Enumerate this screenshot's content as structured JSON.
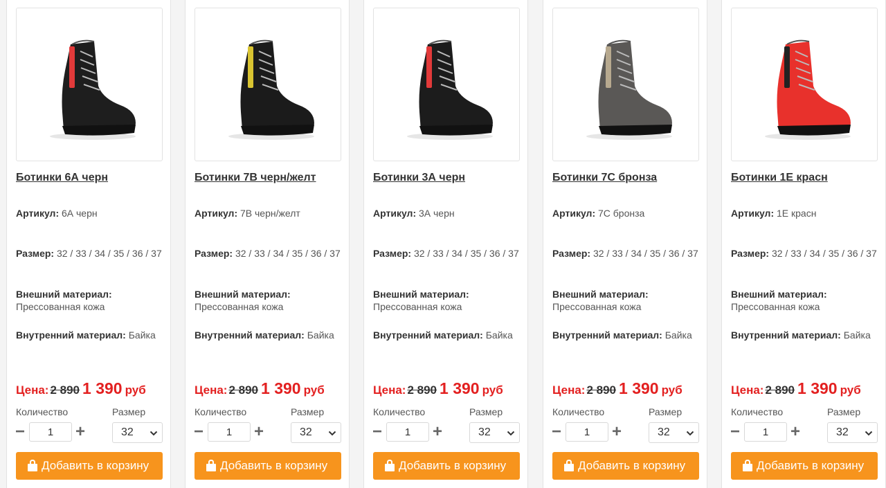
{
  "labels": {
    "article": "Артикул:",
    "size": "Размер:",
    "outer": "Внешний материал:",
    "inner": "Внутренний материал:",
    "price": "Цена:",
    "currency": "руб",
    "quantity": "Количество",
    "size_select": "Размер",
    "add_to_cart": "Добавить в корзину",
    "minus": "−",
    "plus": "+"
  },
  "products": [
    {
      "title": "Ботинки 6А черн",
      "article": "6А черн",
      "sizes": "32 / 33 / 34 / 35 / 36 / 37",
      "outer_material": "Прессованная кожа",
      "inner_material": "Байка",
      "old_price": "2 890",
      "new_price": "1 390",
      "quantity": "1",
      "selected_size": "32",
      "image": "boot-black-red-laces"
    },
    {
      "title": "Ботинки 7В черн/желт",
      "article": "7В черн/желт",
      "sizes": "32 / 33 / 34 / 35 / 36 / 37",
      "outer_material": "Прессованная кожа",
      "inner_material": "Байка",
      "old_price": "2 890",
      "new_price": "1 390",
      "quantity": "1",
      "selected_size": "32",
      "image": "boot-black-yellow"
    },
    {
      "title": "Ботинки 3А черн",
      "article": "3А черн",
      "sizes": "32 / 33 / 34 / 35 / 36 / 37",
      "outer_material": "Прессованная кожа",
      "inner_material": "Байка",
      "old_price": "2 890",
      "new_price": "1 390",
      "quantity": "1",
      "selected_size": "32",
      "image": "boot-black-suede"
    },
    {
      "title": "Ботинки 7С бронза",
      "article": "7С бронза",
      "sizes": "32 / 33 / 34 / 35 / 36 / 37",
      "outer_material": "Прессованная кожа",
      "inner_material": "Байка",
      "old_price": "2 890",
      "new_price": "1 390",
      "quantity": "1",
      "selected_size": "32",
      "image": "boot-bronze"
    },
    {
      "title": "Ботинки 1Е красн",
      "article": "1Е красн",
      "sizes": "32 / 33 / 34 / 35 / 36 / 37",
      "outer_material": "Прессованная кожа",
      "inner_material": "Байка",
      "old_price": "2 890",
      "new_price": "1 390",
      "quantity": "1",
      "selected_size": "32",
      "image": "boot-red"
    }
  ],
  "colors": {
    "accent": "#f7941d",
    "price_red": "#e32020",
    "boot_colors": [
      "#1e1e1e",
      "#1b1b1b",
      "#1c1c1c",
      "#5a5856",
      "#e8312c"
    ],
    "boot_accents": [
      "#e23a3a",
      "#d9c431",
      "#e23a3a",
      "#b7a98f",
      "#222222"
    ]
  }
}
